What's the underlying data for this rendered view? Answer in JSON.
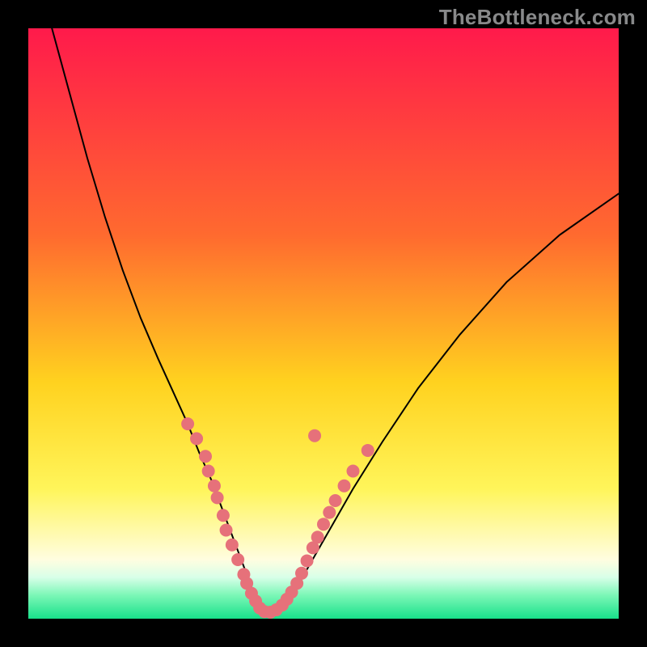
{
  "watermark": "TheBottleneck.com",
  "chart_data": {
    "type": "line",
    "title": "",
    "xlabel": "",
    "ylabel": "",
    "xlim": [
      0,
      100
    ],
    "ylim": [
      0,
      100
    ],
    "gradient_stops": [
      {
        "offset": 0,
        "color": "#ff1a4b"
      },
      {
        "offset": 35,
        "color": "#ff6a2f"
      },
      {
        "offset": 60,
        "color": "#ffd21f"
      },
      {
        "offset": 78,
        "color": "#fff55a"
      },
      {
        "offset": 90,
        "color": "#fffde0"
      },
      {
        "offset": 93,
        "color": "#d8ffe8"
      },
      {
        "offset": 96,
        "color": "#7cf7b7"
      },
      {
        "offset": 100,
        "color": "#18e08a"
      }
    ],
    "series": [
      {
        "name": "bottleneck-curve",
        "type": "line",
        "x": [
          4,
          7,
          10,
          13,
          16,
          19,
          22,
          24.5,
          27,
          29,
          31,
          32.5,
          34,
          35.5,
          37,
          38.2,
          39.2,
          40,
          41,
          42,
          44,
          47,
          51,
          55,
          60,
          66,
          73,
          81,
          90,
          100
        ],
        "y": [
          100,
          89,
          78,
          68,
          59,
          51,
          44,
          38.5,
          33,
          28,
          23.5,
          19.5,
          15.5,
          11.5,
          7.5,
          4.2,
          2.0,
          1.0,
          1.0,
          1.5,
          3.5,
          8,
          15,
          22,
          30,
          39,
          48,
          57,
          65,
          72
        ],
        "stroke": "#000000",
        "stroke_width": 2
      },
      {
        "name": "scatter-points",
        "type": "scatter",
        "points": [
          {
            "x": 27.0,
            "y": 33.0
          },
          {
            "x": 28.5,
            "y": 30.5
          },
          {
            "x": 30.0,
            "y": 27.5
          },
          {
            "x": 30.5,
            "y": 25.0
          },
          {
            "x": 31.5,
            "y": 22.5
          },
          {
            "x": 32.0,
            "y": 20.5
          },
          {
            "x": 33.0,
            "y": 17.5
          },
          {
            "x": 33.5,
            "y": 15.0
          },
          {
            "x": 34.5,
            "y": 12.5
          },
          {
            "x": 35.5,
            "y": 10.0
          },
          {
            "x": 36.5,
            "y": 7.5
          },
          {
            "x": 37.0,
            "y": 6.0
          },
          {
            "x": 37.8,
            "y": 4.3
          },
          {
            "x": 38.5,
            "y": 3.0
          },
          {
            "x": 39.2,
            "y": 1.8
          },
          {
            "x": 40.0,
            "y": 1.2
          },
          {
            "x": 41.0,
            "y": 1.1
          },
          {
            "x": 42.0,
            "y": 1.5
          },
          {
            "x": 43.0,
            "y": 2.3
          },
          {
            "x": 43.8,
            "y": 3.3
          },
          {
            "x": 44.6,
            "y": 4.5
          },
          {
            "x": 45.5,
            "y": 6.0
          },
          {
            "x": 46.3,
            "y": 7.7
          },
          {
            "x": 47.2,
            "y": 9.8
          },
          {
            "x": 48.2,
            "y": 12.0
          },
          {
            "x": 49.0,
            "y": 13.8
          },
          {
            "x": 50.0,
            "y": 16.0
          },
          {
            "x": 51.0,
            "y": 18.0
          },
          {
            "x": 52.0,
            "y": 20.0
          },
          {
            "x": 53.5,
            "y": 22.5
          },
          {
            "x": 55.0,
            "y": 25.0
          },
          {
            "x": 57.5,
            "y": 28.5
          },
          {
            "x": 48.5,
            "y": 31.0
          }
        ],
        "fill": "#e6717a",
        "radius": 8
      }
    ]
  }
}
